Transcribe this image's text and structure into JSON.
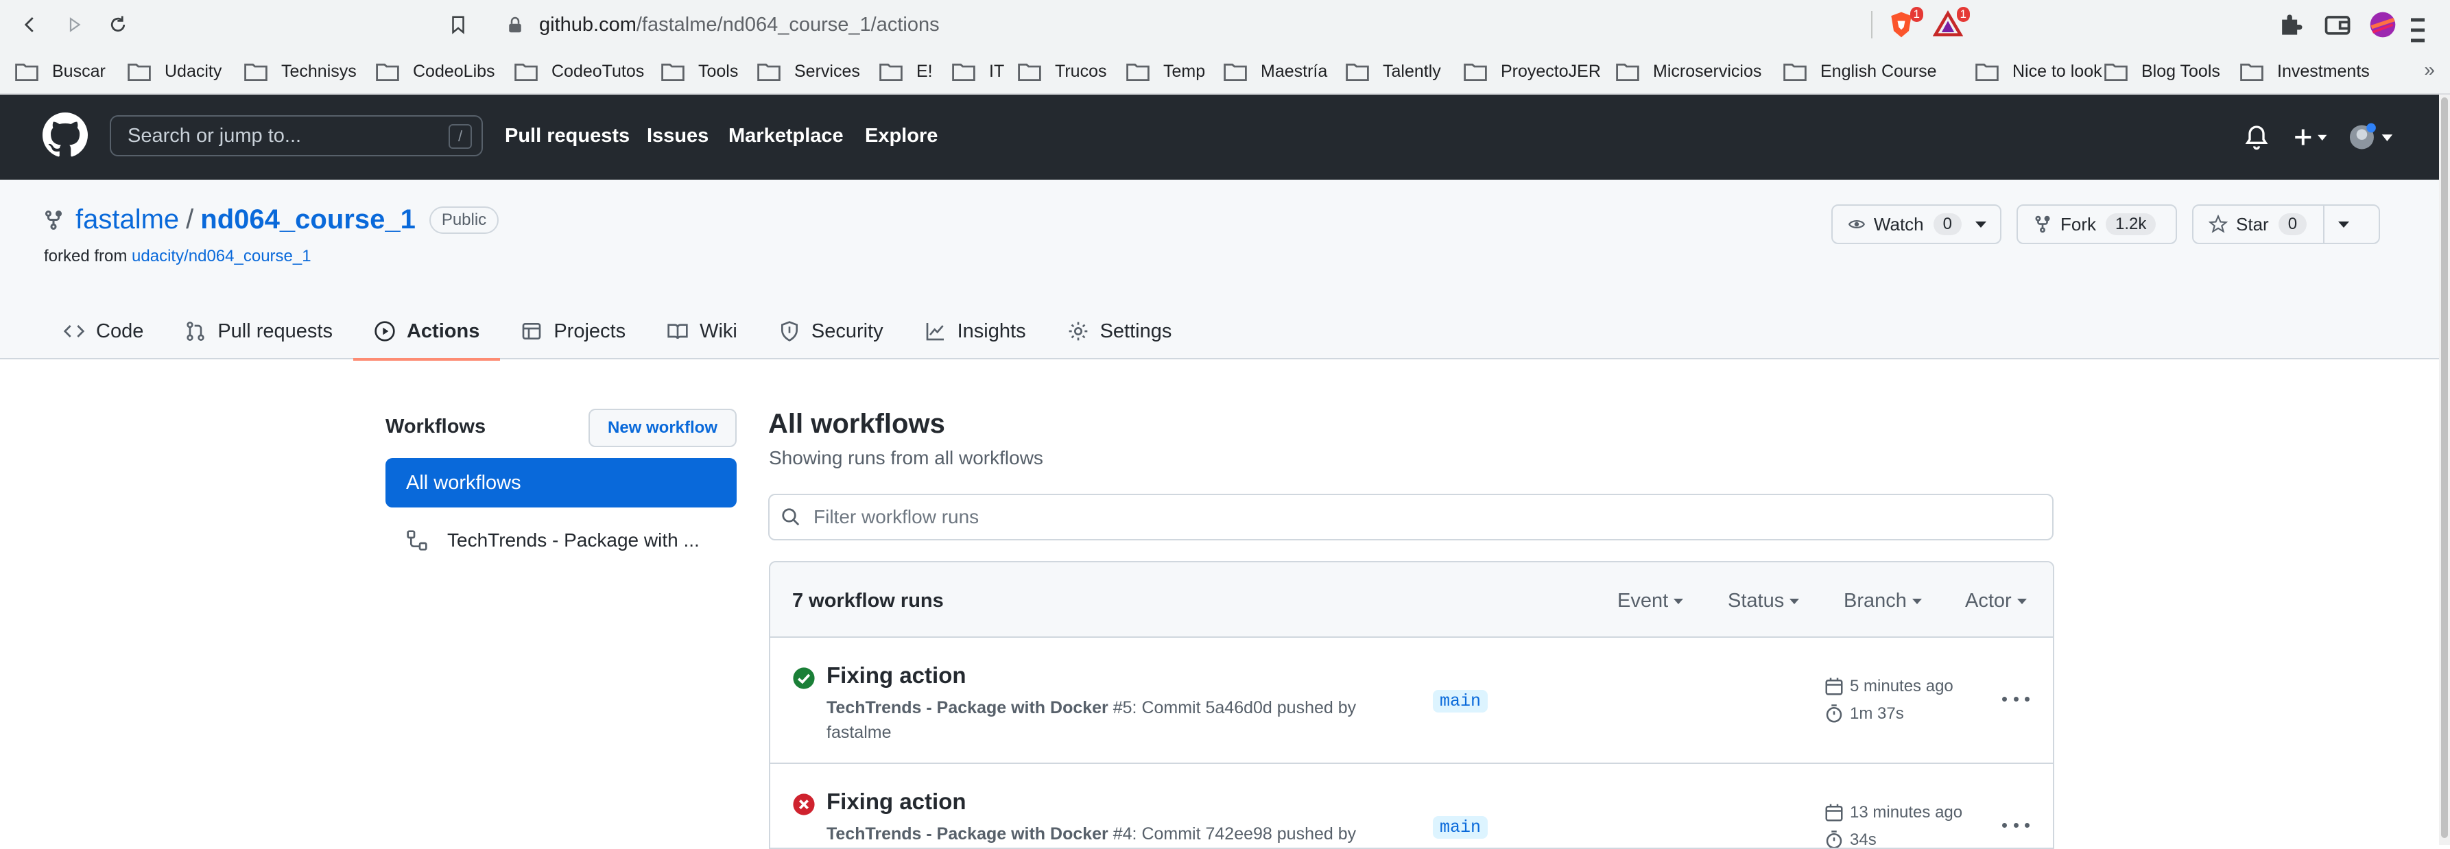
{
  "browser": {
    "url_host": "github.com",
    "url_path": "/fastalme/nd064_course_1/actions",
    "ext_badge_1": "1",
    "ext_badge_2": "1",
    "bookmarks": [
      "Buscar",
      "Udacity",
      "Technisys",
      "CodeoLibs",
      "CodeoTutos",
      "Tools",
      "Services",
      "E!",
      "IT",
      "Trucos",
      "Temp",
      "Maestría",
      "Talently",
      "ProyectoJER",
      "Microservicios",
      "English Course",
      "Nice to look",
      "Blog Tools",
      "Investments"
    ],
    "bookmarks_more": "»"
  },
  "header": {
    "search_placeholder": "Search or jump to...",
    "search_shortcut": "/",
    "nav": [
      "Pull requests",
      "Issues",
      "Marketplace",
      "Explore"
    ]
  },
  "repo": {
    "owner": "fastalme",
    "separator": "/",
    "name": "nd064_course_1",
    "visibility": "Public",
    "forked_prefix": "forked from",
    "forked_from": "udacity/nd064_course_1",
    "watch_label": "Watch",
    "watch_count": "0",
    "fork_label": "Fork",
    "fork_count": "1.2k",
    "star_label": "Star",
    "star_count": "0",
    "tabs": [
      "Code",
      "Pull requests",
      "Actions",
      "Projects",
      "Wiki",
      "Security",
      "Insights",
      "Settings"
    ]
  },
  "sidebar": {
    "title": "Workflows",
    "new_workflow": "New workflow",
    "all_workflows": "All workflows",
    "workflow_item": "TechTrends - Package with ..."
  },
  "main": {
    "title": "All workflows",
    "subtitle": "Showing runs from all workflows",
    "filter_placeholder": "Filter workflow runs",
    "runs_count": "7 workflow runs",
    "filters": [
      "Event",
      "Status",
      "Branch",
      "Actor"
    ],
    "runs": [
      {
        "status": "success",
        "title": "Fixing action",
        "workflow": "TechTrends - Package with Docker",
        "detail": " #5: Commit 5a46d0d pushed by fastalme",
        "branch": "main",
        "time_ago": "5 minutes ago",
        "duration": "1m 37s"
      },
      {
        "status": "failure",
        "title": "Fixing action",
        "workflow": "TechTrends - Package with Docker",
        "detail": " #4: Commit 742ee98 pushed by",
        "branch": "main",
        "time_ago": "13 minutes ago",
        "duration": "34s"
      }
    ]
  },
  "colors": {
    "header_bg": "#24292f",
    "link": "#0969da",
    "success": "#1a7f37",
    "failure": "#cf222e",
    "active_tab_underline": "#fd8c73"
  }
}
